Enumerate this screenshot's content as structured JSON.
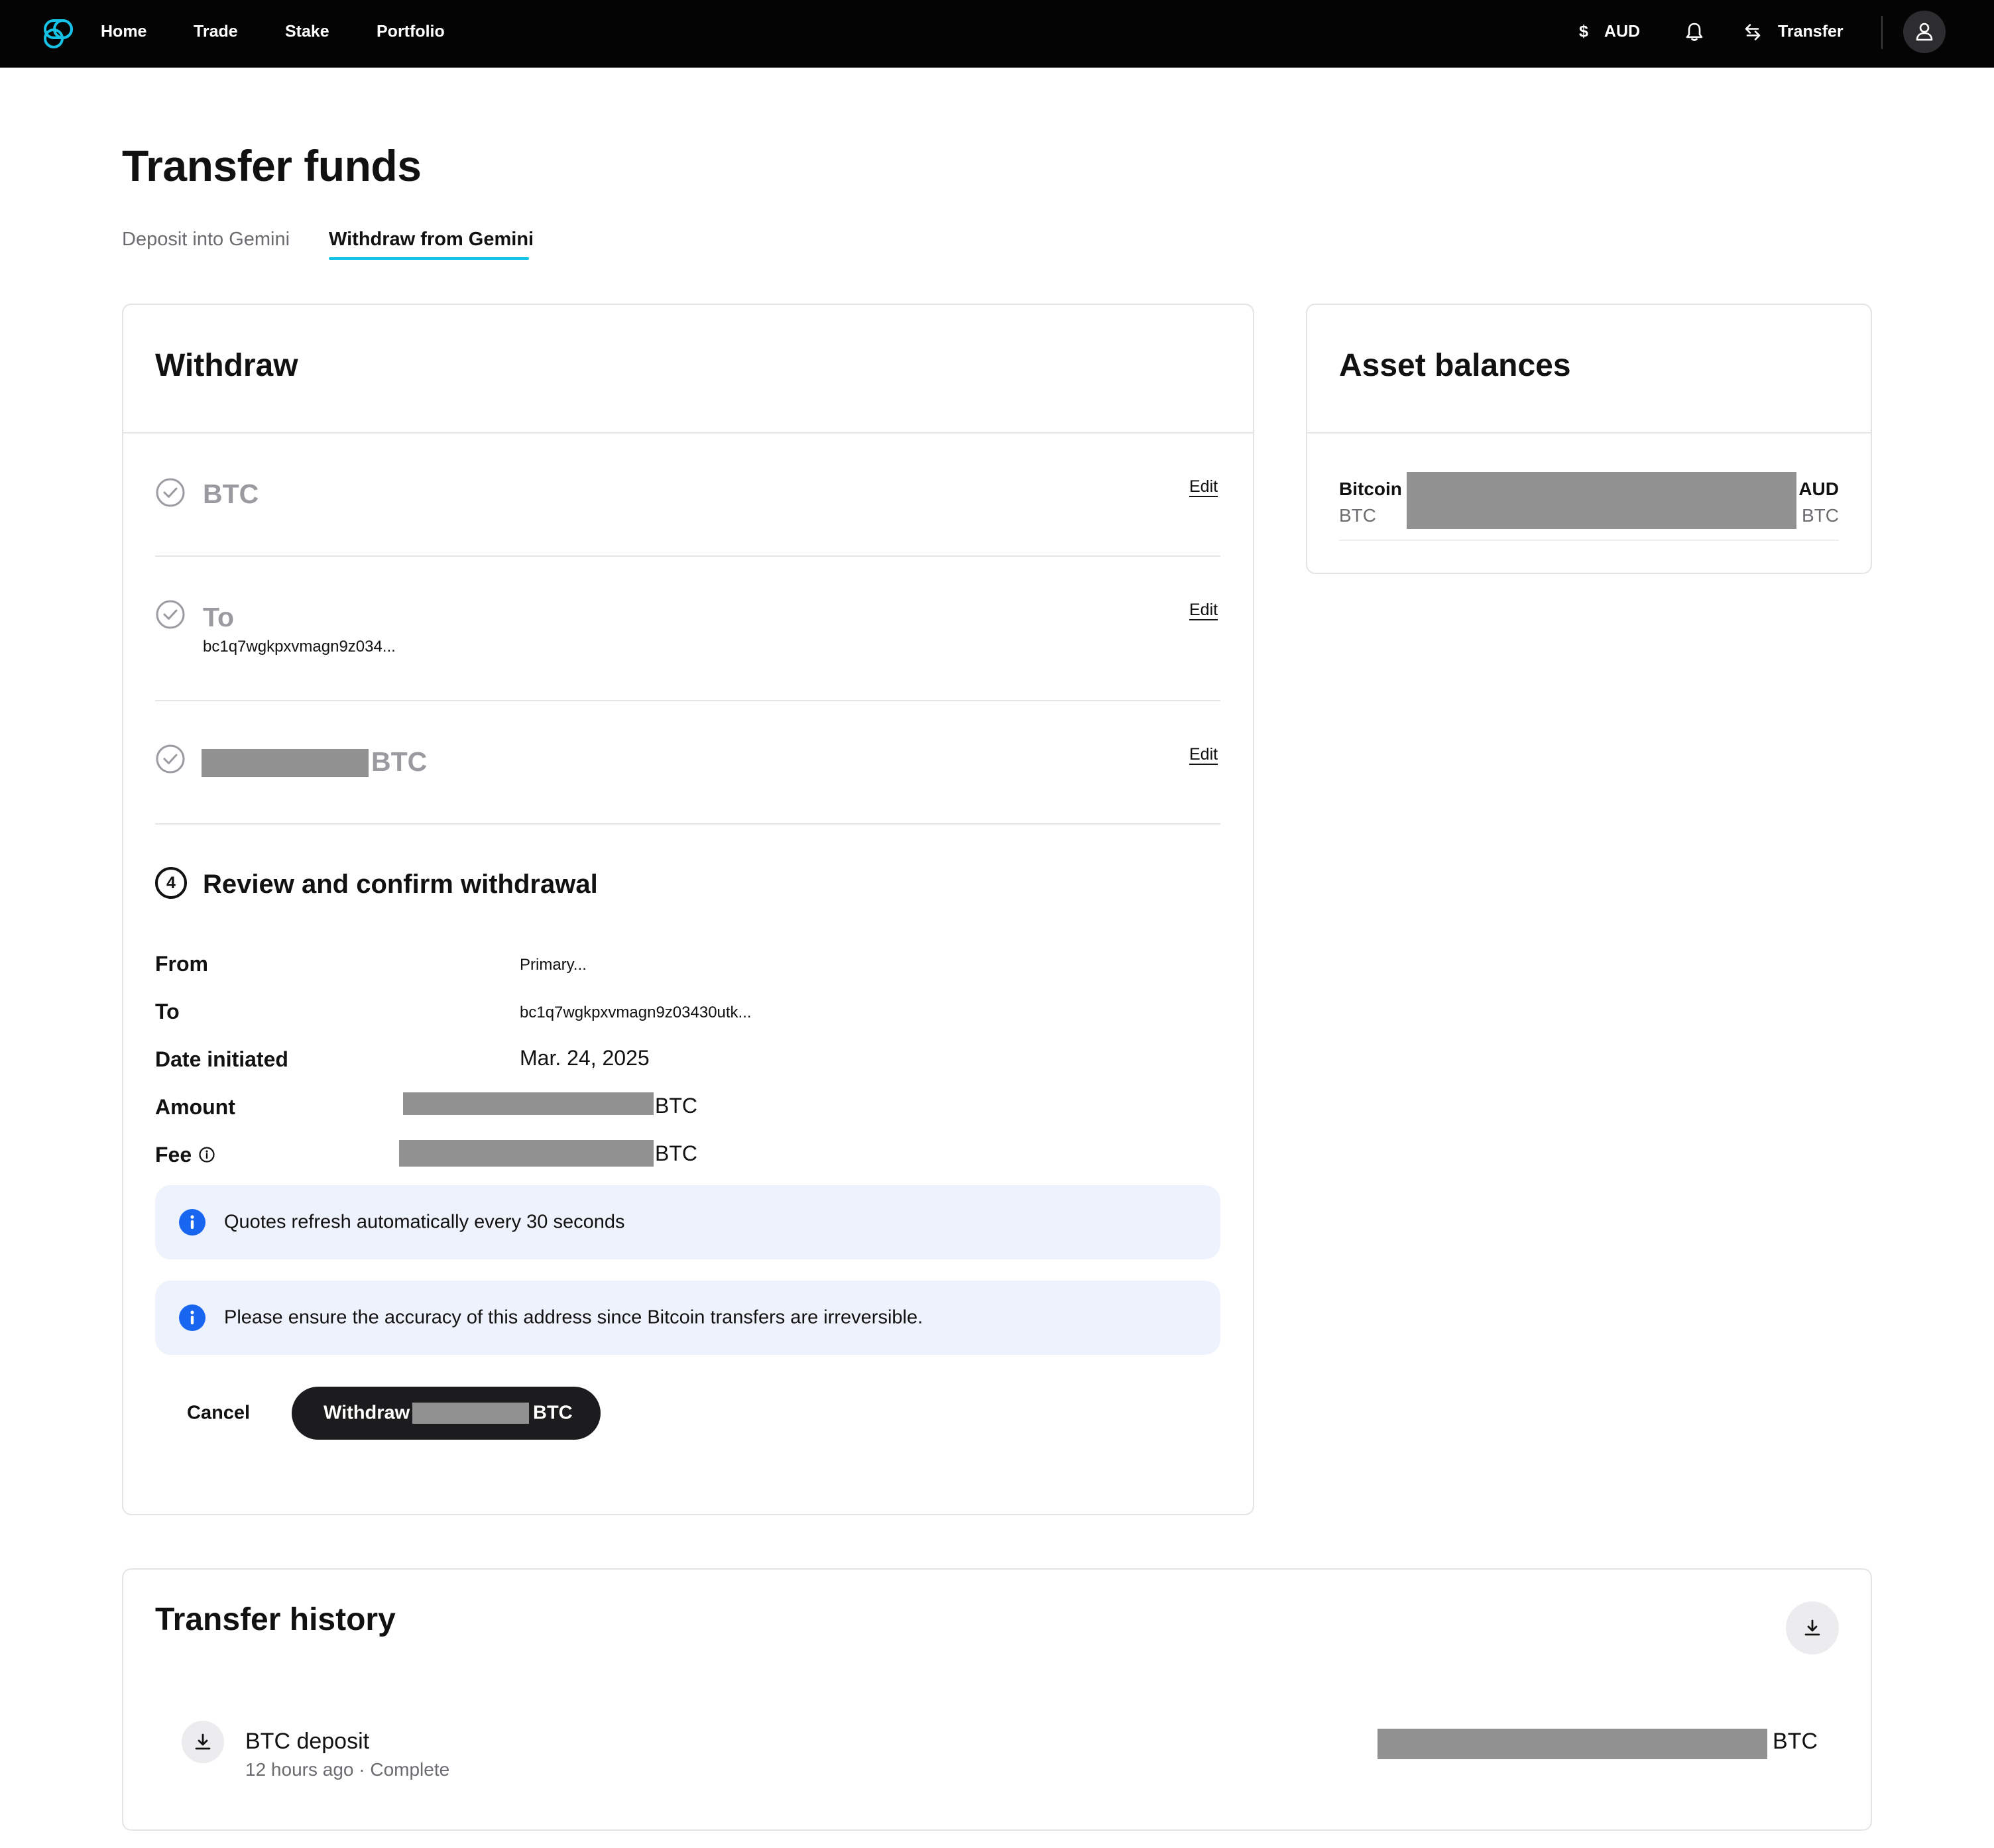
{
  "colors": {
    "topbar_bg": "#040405",
    "accent": "#16c2e6",
    "info_blue": "#1866f0",
    "notice_bg": "#eef2fc",
    "primary_button": "#1c1c1e",
    "redaction": "#919191"
  },
  "nav": {
    "logo_icon": "gemini-logo-icon",
    "links": [
      "Home",
      "Trade",
      "Stake",
      "Portfolio"
    ],
    "currency_symbol": "$",
    "currency_label": "AUD",
    "notifications_icon": "bell-icon",
    "transfer_label": "Transfer",
    "transfer_icon": "transfer-arrows-icon",
    "account_icon": "user-icon"
  },
  "page": {
    "title": "Transfer funds",
    "tabs": [
      {
        "label": "Deposit into Gemini",
        "active": false
      },
      {
        "label": "Withdraw from Gemini",
        "active": true
      }
    ]
  },
  "withdraw": {
    "title": "Withdraw",
    "steps": [
      {
        "label": "BTC",
        "detail": "",
        "edit_label": "Edit",
        "completed": true
      },
      {
        "label": "To",
        "detail": "bc1q7wgkpxvmagn9z034...",
        "edit_label": "Edit",
        "completed": true
      },
      {
        "label": "BTC",
        "detail": "",
        "edit_label": "Edit",
        "completed": true,
        "amount_redacted": true
      }
    ],
    "review": {
      "step_number": "4",
      "title": "Review and confirm withdrawal",
      "rows": {
        "from": {
          "label": "From",
          "value": "Primary..."
        },
        "to": {
          "label": "To",
          "value": "bc1q7wgkpxvmagn9z03430utk..."
        },
        "date": {
          "label": "Date initiated",
          "value": "Mar. 24, 2025"
        },
        "amount": {
          "label": "Amount",
          "unit": "BTC"
        },
        "fee": {
          "label": "Fee",
          "unit": "BTC",
          "info_icon": "info-circle-icon"
        }
      },
      "notices": [
        {
          "icon": "info-icon",
          "text": "Quotes refresh automatically every 30 seconds"
        },
        {
          "icon": "info-icon",
          "text": "Please ensure the accuracy of this address since Bitcoin transfers are irreversible."
        }
      ],
      "cancel_label": "Cancel",
      "withdraw_prefix": "Withdraw",
      "withdraw_suffix": "BTC"
    }
  },
  "balances": {
    "title": "Asset balances",
    "items": [
      {
        "name": "Bitcoin",
        "symbol": "BTC",
        "fiat_unit": "AUD",
        "crypto_unit": "BTC"
      }
    ]
  },
  "history": {
    "title": "Transfer history",
    "download_icon": "download-icon",
    "items": [
      {
        "title": "BTC deposit",
        "subtitle": "12 hours ago · Complete",
        "unit": "BTC",
        "icon": "deposit-arrow-icon"
      }
    ]
  }
}
